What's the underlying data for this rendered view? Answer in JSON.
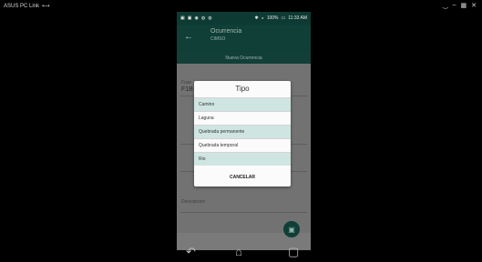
{
  "window": {
    "title": "ASUS PC Link"
  },
  "phone": {
    "status": {
      "battery": "100%",
      "time": "11:33 AM"
    },
    "app_bar": {
      "title": "Ocurrencia",
      "subtitle": "CIMSO"
    },
    "tab": {
      "label": "Nueva Ocurrencia"
    },
    "form": {
      "label_fuente": "Fuse",
      "value_fuente": "F1B- Cuadrante 1",
      "label_misc": "Descripcion"
    },
    "dialog": {
      "title": "Tipo",
      "items": [
        {
          "label": "Camino"
        },
        {
          "label": "Laguna"
        },
        {
          "label": "Quebrada permanente"
        },
        {
          "label": "Quebrada temporal"
        },
        {
          "label": "Rio"
        }
      ],
      "cancel_label": "CANCELAR"
    }
  }
}
